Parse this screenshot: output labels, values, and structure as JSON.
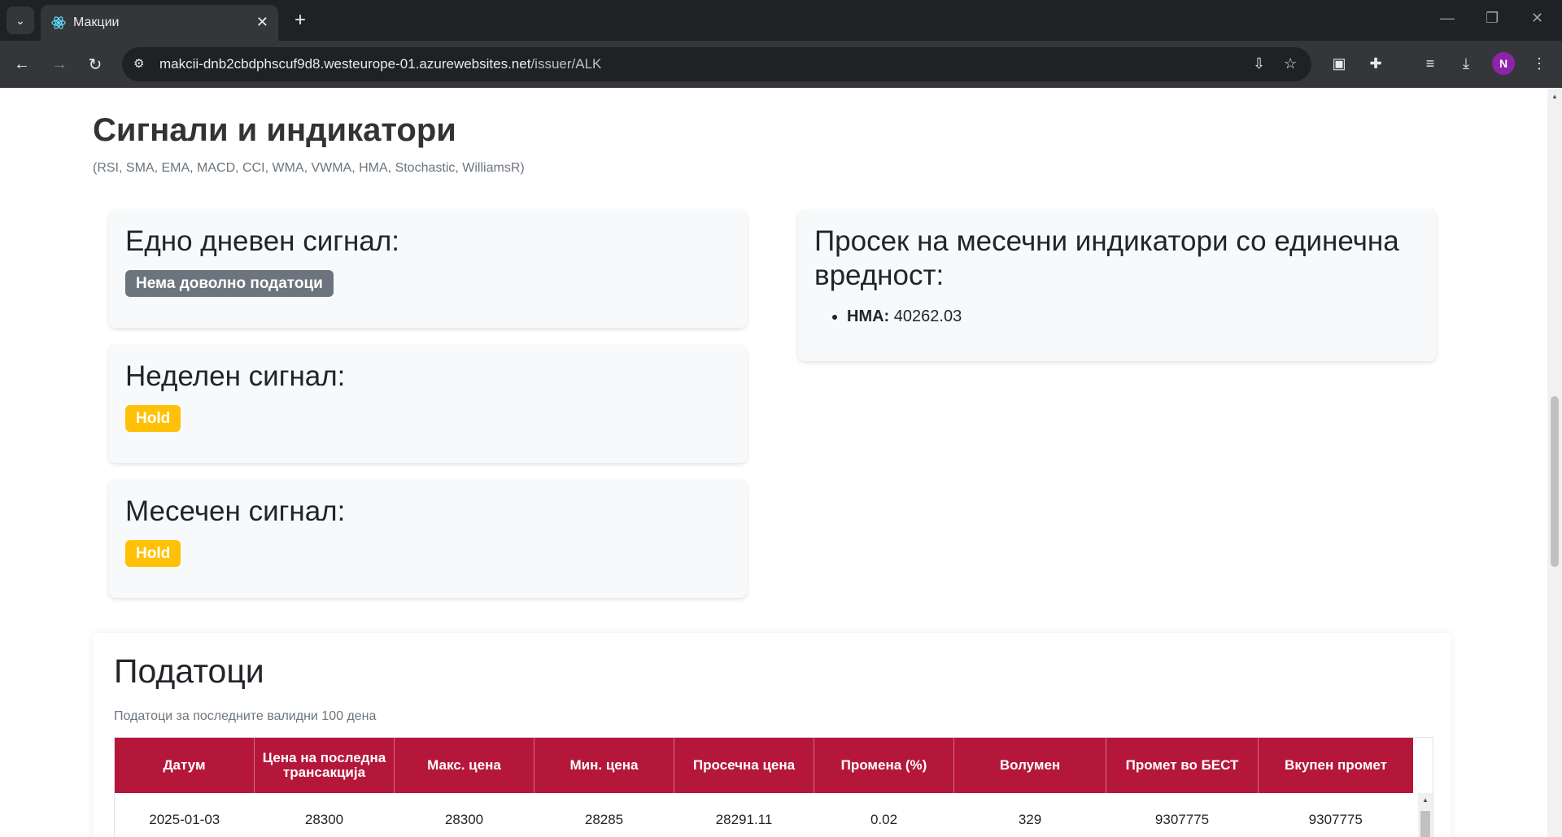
{
  "browser": {
    "tab_title": "Макции",
    "url_host": "makcii-dnb2cbdphscuf9d8.westeurope-01.azurewebsites.net",
    "url_path": "/issuer/ALK",
    "profile_initial": "N"
  },
  "signals": {
    "heading": "Сигнали и индикатори",
    "subheading": "(RSI, SMA, EMA, MACD, CCI, WMA, VWMA, HMA, Stochastic, WilliamsR)",
    "daily": {
      "title": "Едно дневен сигнал:",
      "value": "Нема доволно податоци",
      "color": "#6c757d"
    },
    "weekly": {
      "title": "Неделен сигнал:",
      "value": "Hold",
      "color": "#ffc107"
    },
    "monthly": {
      "title": "Месечен сигнал:",
      "value": "Hold",
      "color": "#ffc107"
    },
    "monthly_avg": {
      "title": "Просек на месечни индикатори со единечна вредност:",
      "items": [
        {
          "label": "HMA:",
          "value": "40262.03"
        }
      ]
    }
  },
  "data": {
    "heading": "Податоци",
    "subheading": "Податоци за последните валидни 100 дена",
    "header_color": "#b5173b",
    "columns": [
      "Датум",
      "Цена на последна трансакција",
      "Макс. цена",
      "Мин. цена",
      "Просечна цена",
      "Промена (%)",
      "Волумен",
      "Промет во БЕСТ",
      "Вкупен промет"
    ],
    "rows": [
      [
        "2025-01-03",
        "28300",
        "28300",
        "28285",
        "28291.11",
        "0.02",
        "329",
        "9307775",
        "9307775"
      ]
    ]
  }
}
